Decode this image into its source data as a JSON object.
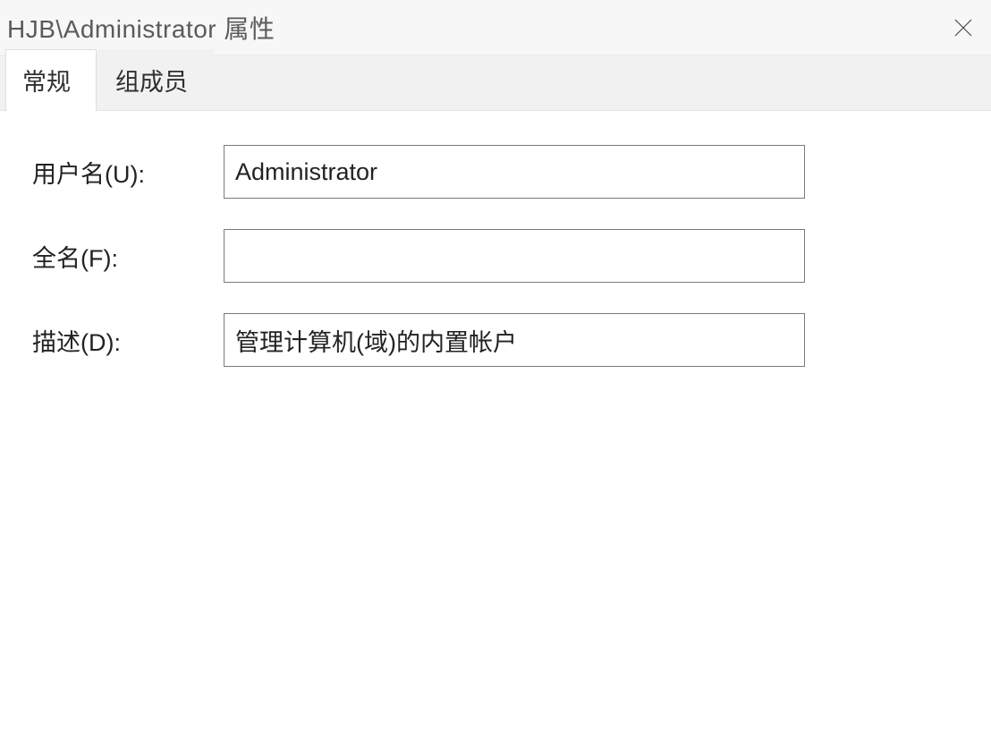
{
  "window": {
    "title": "HJB\\Administrator 属性"
  },
  "tabs": {
    "general": "常规",
    "members": "组成员"
  },
  "form": {
    "username": {
      "label": "用户名(U):",
      "value": "Administrator"
    },
    "fullname": {
      "label": "全名(F):",
      "value": ""
    },
    "description": {
      "label": "描述(D):",
      "value": "管理计算机(域)的内置帐户"
    }
  }
}
